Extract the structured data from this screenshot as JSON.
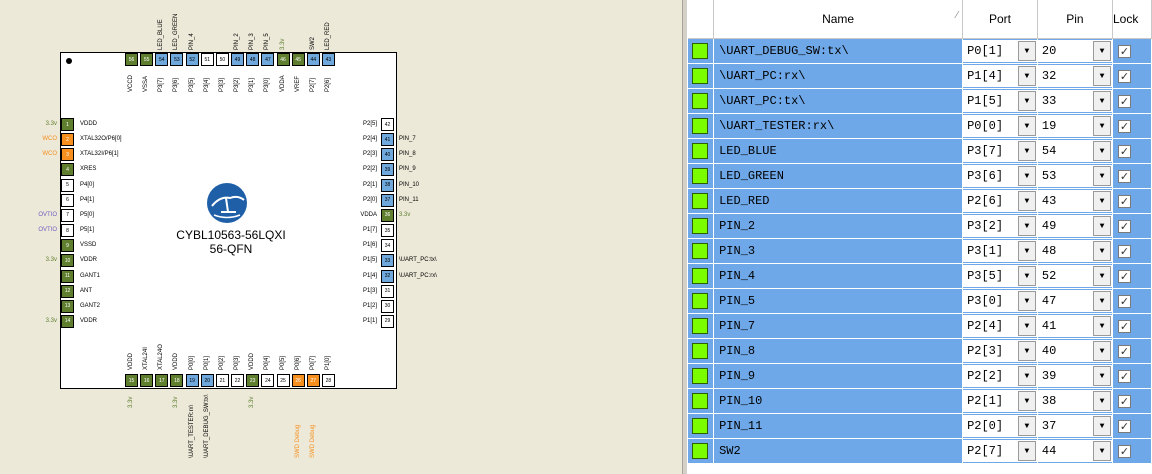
{
  "chip": {
    "name": "CYBL10563-56LQXI",
    "package": "56-QFN",
    "top_pins": [
      {
        "num": "56",
        "label": "VCCD",
        "color": "g",
        "ext": ""
      },
      {
        "num": "55",
        "label": "VSSA",
        "color": "g",
        "ext": ""
      },
      {
        "num": "54",
        "label": "P3[7]",
        "color": "b",
        "ext": "LED_BLUE"
      },
      {
        "num": "53",
        "label": "P3[6]",
        "color": "b",
        "ext": "LED_GREEN"
      },
      {
        "num": "52",
        "label": "P3[5]",
        "color": "b",
        "ext": "PIN_4"
      },
      {
        "num": "51",
        "label": "P3[4]",
        "color": "w",
        "ext": ""
      },
      {
        "num": "50",
        "label": "P3[3]",
        "color": "w",
        "ext": ""
      },
      {
        "num": "49",
        "label": "P3[2]",
        "color": "b",
        "ext": "PIN_2"
      },
      {
        "num": "48",
        "label": "P3[1]",
        "color": "b",
        "ext": "PIN_3"
      },
      {
        "num": "47",
        "label": "P3[0]",
        "color": "b",
        "ext": "PIN_5"
      },
      {
        "num": "46",
        "label": "VDDA",
        "color": "g",
        "ext": "3.3v"
      },
      {
        "num": "45",
        "label": "VREF",
        "color": "g",
        "ext": ""
      },
      {
        "num": "44",
        "label": "P2[7]",
        "color": "b",
        "ext": "SW2"
      },
      {
        "num": "43",
        "label": "P2[6]",
        "color": "b",
        "ext": "LED_RED"
      }
    ],
    "left_pins": [
      {
        "num": "1",
        "label": "VDDD",
        "color": "g",
        "ext": "3.3v",
        "extc": "#5f7f2f"
      },
      {
        "num": "2",
        "label": "XTAL32O/P6[0]",
        "color": "o",
        "ext": "WCO",
        "extc": "#f68f1e"
      },
      {
        "num": "3",
        "label": "XTAL32I/P6[1]",
        "color": "o",
        "ext": "WCO",
        "extc": "#f68f1e"
      },
      {
        "num": "4",
        "label": "XRES",
        "color": "g",
        "ext": "",
        "extc": ""
      },
      {
        "num": "5",
        "label": "P4[0]",
        "color": "w",
        "ext": "",
        "extc": ""
      },
      {
        "num": "6",
        "label": "P4[1]",
        "color": "w",
        "ext": "",
        "extc": ""
      },
      {
        "num": "7",
        "label": "P5[0]",
        "color": "w",
        "ext": "OVTIO",
        "extc": "#7060c0"
      },
      {
        "num": "8",
        "label": "P5[1]",
        "color": "w",
        "ext": "OVTIO",
        "extc": "#7060c0"
      },
      {
        "num": "9",
        "label": "VSSD",
        "color": "g",
        "ext": "",
        "extc": ""
      },
      {
        "num": "10",
        "label": "VDDR",
        "color": "g",
        "ext": "3.3v",
        "extc": "#5f7f2f"
      },
      {
        "num": "11",
        "label": "GANT1",
        "color": "g",
        "ext": "",
        "extc": ""
      },
      {
        "num": "12",
        "label": "ANT",
        "color": "g",
        "ext": "",
        "extc": ""
      },
      {
        "num": "13",
        "label": "GANT2",
        "color": "g",
        "ext": "",
        "extc": ""
      },
      {
        "num": "14",
        "label": "VDDR",
        "color": "g",
        "ext": "3.3v",
        "extc": "#5f7f2f"
      }
    ],
    "right_pins": [
      {
        "num": "42",
        "label": "P2[5]",
        "color": "w",
        "ext": "",
        "extc": ""
      },
      {
        "num": "41",
        "label": "P2[4]",
        "color": "b",
        "ext": "PIN_7",
        "extc": "#000"
      },
      {
        "num": "40",
        "label": "P2[3]",
        "color": "b",
        "ext": "PIN_8",
        "extc": "#000"
      },
      {
        "num": "39",
        "label": "P2[2]",
        "color": "b",
        "ext": "PIN_9",
        "extc": "#000"
      },
      {
        "num": "38",
        "label": "P2[1]",
        "color": "b",
        "ext": "PIN_10",
        "extc": "#000"
      },
      {
        "num": "37",
        "label": "P2[0]",
        "color": "b",
        "ext": "PIN_11",
        "extc": "#000"
      },
      {
        "num": "36",
        "label": "VDDA",
        "color": "g",
        "ext": "3.3v",
        "extc": "#5f7f2f"
      },
      {
        "num": "35",
        "label": "P1[7]",
        "color": "w",
        "ext": "",
        "extc": ""
      },
      {
        "num": "34",
        "label": "P1[6]",
        "color": "w",
        "ext": "",
        "extc": ""
      },
      {
        "num": "33",
        "label": "P1[5]",
        "color": "b",
        "ext": "\\UART_PC:tx\\",
        "extc": "#000"
      },
      {
        "num": "32",
        "label": "P1[4]",
        "color": "b",
        "ext": "\\UART_PC:rx\\",
        "extc": "#000"
      },
      {
        "num": "31",
        "label": "P1[3]",
        "color": "w",
        "ext": "",
        "extc": ""
      },
      {
        "num": "30",
        "label": "P1[2]",
        "color": "w",
        "ext": "",
        "extc": ""
      },
      {
        "num": "29",
        "label": "P1[1]",
        "color": "w",
        "ext": "",
        "extc": ""
      }
    ],
    "bottom_pins": [
      {
        "num": "15",
        "label": "VDDD",
        "color": "g",
        "ext": "3.3v",
        "extc": "#5f7f2f"
      },
      {
        "num": "16",
        "label": "XTAL24I",
        "color": "g",
        "ext": "",
        "extc": ""
      },
      {
        "num": "17",
        "label": "XTAL24O",
        "color": "g",
        "ext": "",
        "extc": ""
      },
      {
        "num": "18",
        "label": "VDDD",
        "color": "g",
        "ext": "3.3v",
        "extc": "#5f7f2f"
      },
      {
        "num": "19",
        "label": "P0[0]",
        "color": "b",
        "ext": "\\UART_TESTER:rx\\",
        "extc": "#000"
      },
      {
        "num": "20",
        "label": "P0[1]",
        "color": "b",
        "ext": "\\UART_DEBUG_SW:tx\\",
        "extc": "#000"
      },
      {
        "num": "21",
        "label": "P0[2]",
        "color": "w",
        "ext": "",
        "extc": ""
      },
      {
        "num": "22",
        "label": "P0[3]",
        "color": "w",
        "ext": "",
        "extc": ""
      },
      {
        "num": "23",
        "label": "VDDD",
        "color": "g",
        "ext": "3.3v",
        "extc": "#5f7f2f"
      },
      {
        "num": "24",
        "label": "P0[4]",
        "color": "w",
        "ext": "",
        "extc": ""
      },
      {
        "num": "25",
        "label": "P0[5]",
        "color": "w",
        "ext": "",
        "extc": ""
      },
      {
        "num": "26",
        "label": "P0[6]",
        "color": "o",
        "ext": "SWD Debug",
        "extc": "#f68f1e"
      },
      {
        "num": "27",
        "label": "P0[7]",
        "color": "o",
        "ext": "SWD Debug",
        "extc": "#f68f1e"
      },
      {
        "num": "28",
        "label": "P1[0]",
        "color": "w",
        "ext": "",
        "extc": ""
      }
    ]
  },
  "table": {
    "headers": {
      "name": "Name",
      "port": "Port",
      "pin": "Pin",
      "lock": "Lock"
    },
    "rows": [
      {
        "name": "\\UART_DEBUG_SW:tx\\",
        "port": "P0[1]",
        "pin": "20",
        "lock": "✓"
      },
      {
        "name": "\\UART_PC:rx\\",
        "port": "P1[4]",
        "pin": "32",
        "lock": "✓"
      },
      {
        "name": "\\UART_PC:tx\\",
        "port": "P1[5]",
        "pin": "33",
        "lock": "✓"
      },
      {
        "name": "\\UART_TESTER:rx\\",
        "port": "P0[0]",
        "pin": "19",
        "lock": "✓"
      },
      {
        "name": "LED_BLUE",
        "port": "P3[7]",
        "pin": "54",
        "lock": "✓"
      },
      {
        "name": "LED_GREEN",
        "port": "P3[6]",
        "pin": "53",
        "lock": "✓"
      },
      {
        "name": "LED_RED",
        "port": "P2[6]",
        "pin": "43",
        "lock": "✓"
      },
      {
        "name": "PIN_2",
        "port": "P3[2]",
        "pin": "49",
        "lock": "✓"
      },
      {
        "name": "PIN_3",
        "port": "P3[1]",
        "pin": "48",
        "lock": "✓"
      },
      {
        "name": "PIN_4",
        "port": "P3[5]",
        "pin": "52",
        "lock": "✓"
      },
      {
        "name": "PIN_5",
        "port": "P3[0]",
        "pin": "47",
        "lock": "✓"
      },
      {
        "name": "PIN_7",
        "port": "P2[4]",
        "pin": "41",
        "lock": "✓"
      },
      {
        "name": "PIN_8",
        "port": "P2[3]",
        "pin": "40",
        "lock": "✓"
      },
      {
        "name": "PIN_9",
        "port": "P2[2]",
        "pin": "39",
        "lock": "✓"
      },
      {
        "name": "PIN_10",
        "port": "P2[1]",
        "pin": "38",
        "lock": "✓"
      },
      {
        "name": "PIN_11",
        "port": "P2[0]",
        "pin": "37",
        "lock": "✓"
      },
      {
        "name": "SW2",
        "port": "P2[7]",
        "pin": "44",
        "lock": "✓"
      }
    ]
  },
  "colors": {
    "swatch": "#7cfc00",
    "row_bg": "#6fa8e8",
    "pin_green": "#5f7f2f",
    "pin_blue": "#6fa8dc",
    "pin_orange": "#f68f1e"
  }
}
